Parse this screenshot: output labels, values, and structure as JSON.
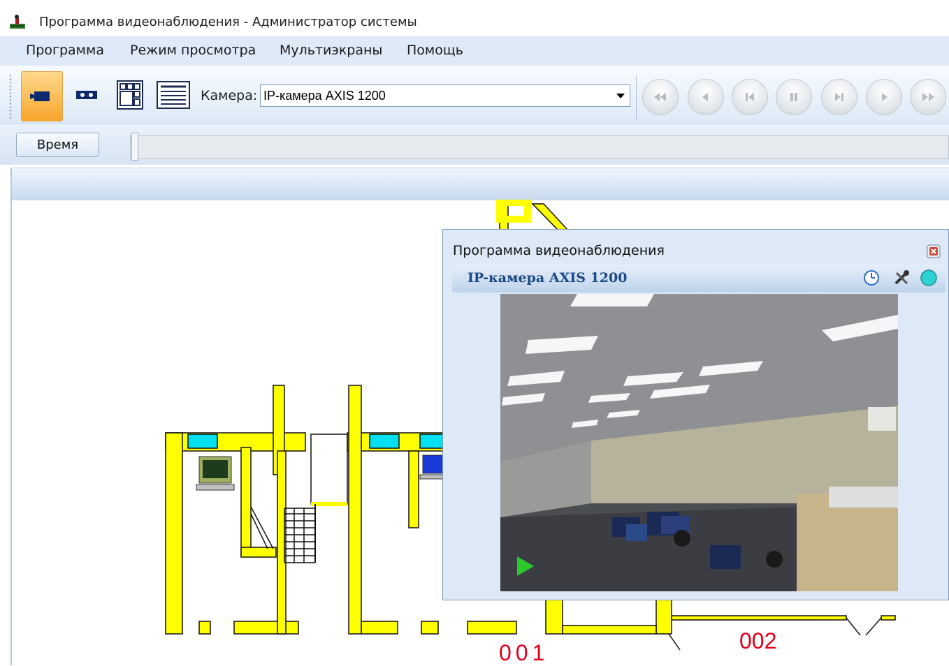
{
  "window": {
    "title": "Программа видеонаблюдения - Администратор системы"
  },
  "menu": {
    "items": [
      "Программа",
      "Режим просмотра",
      "Мультиэкраны",
      "Помощь"
    ]
  },
  "toolbar": {
    "camera_label": "Камера:",
    "camera_selected": "IP-камера AXIS 1200",
    "buttons": [
      "live-camera-icon",
      "playback-icon",
      "multiscreen-icon",
      "list-icon"
    ],
    "playback": [
      "rewind-icon",
      "step-back-icon",
      "go-start-icon",
      "pause-icon",
      "go-end-icon",
      "play-icon",
      "fast-forward-icon"
    ]
  },
  "timeline": {
    "time_button": "Время"
  },
  "camera_window": {
    "title": "Программа видеонаблюдения",
    "camera_name": "IP-камера AXIS 1200",
    "icons": [
      "clock-icon",
      "tools-icon",
      "status-dot-icon"
    ],
    "status_color": "#2ed1d1"
  },
  "floorplan": {
    "zone_labels": [
      "001",
      "002"
    ],
    "wall_color": "#ffff00",
    "window_color": "#00e0f0"
  }
}
